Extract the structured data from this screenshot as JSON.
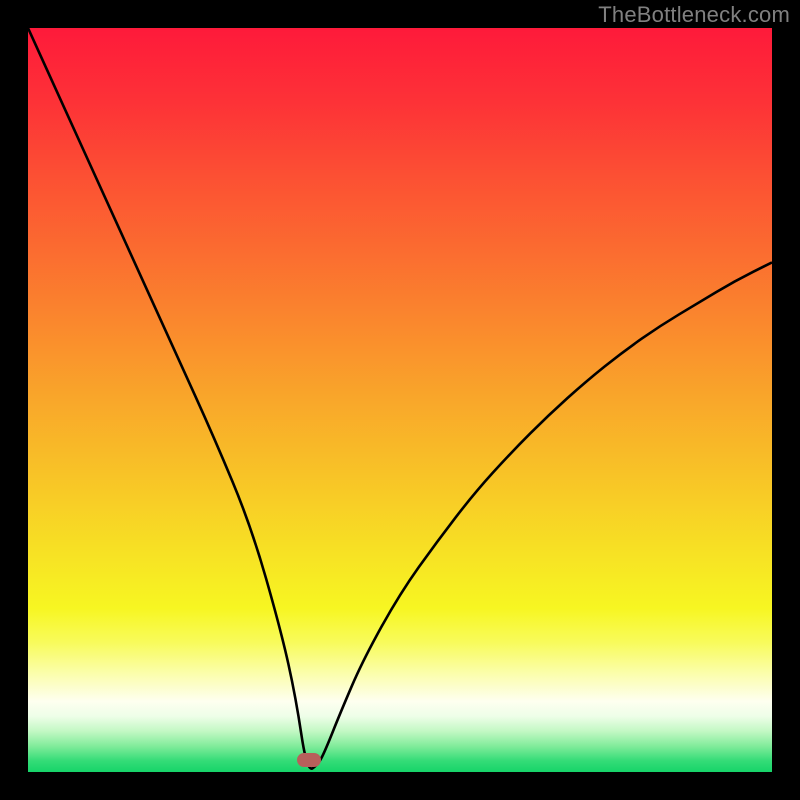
{
  "watermark": "TheBottleneck.com",
  "chart_data": {
    "type": "line",
    "title": "",
    "xlabel": "",
    "ylabel": "",
    "xlim": [
      0,
      100
    ],
    "ylim": [
      0,
      100
    ],
    "curve": {
      "x": [
        0,
        5,
        10,
        15,
        20,
        25,
        30,
        34,
        36,
        37.5,
        39,
        40,
        42,
        45,
        50,
        55,
        60,
        65,
        70,
        75,
        80,
        85,
        90,
        95,
        100
      ],
      "y": [
        100,
        89,
        78,
        67,
        56,
        45,
        33,
        19,
        10,
        0,
        1,
        3,
        8,
        15,
        24,
        31,
        37.5,
        43,
        48,
        52.5,
        56.5,
        60,
        63,
        66,
        68.5
      ]
    },
    "marker": {
      "x": 37.8,
      "y": 1.6,
      "color": "#b7605b"
    },
    "gradient_stops": [
      {
        "offset": 0,
        "color": "#fe1a3a"
      },
      {
        "offset": 0.1,
        "color": "#fd3237"
      },
      {
        "offset": 0.2,
        "color": "#fc5033"
      },
      {
        "offset": 0.3,
        "color": "#fb6c30"
      },
      {
        "offset": 0.4,
        "color": "#fa892d"
      },
      {
        "offset": 0.5,
        "color": "#f9a72a"
      },
      {
        "offset": 0.6,
        "color": "#f8c327"
      },
      {
        "offset": 0.7,
        "color": "#f7e024"
      },
      {
        "offset": 0.78,
        "color": "#f7f622"
      },
      {
        "offset": 0.825,
        "color": "#f8fb5a"
      },
      {
        "offset": 0.87,
        "color": "#fbfeb0"
      },
      {
        "offset": 0.905,
        "color": "#fefff0"
      },
      {
        "offset": 0.925,
        "color": "#eefee8"
      },
      {
        "offset": 0.945,
        "color": "#c3f8c4"
      },
      {
        "offset": 0.965,
        "color": "#82ec9b"
      },
      {
        "offset": 0.985,
        "color": "#34dc77"
      },
      {
        "offset": 1.0,
        "color": "#16d469"
      }
    ]
  }
}
